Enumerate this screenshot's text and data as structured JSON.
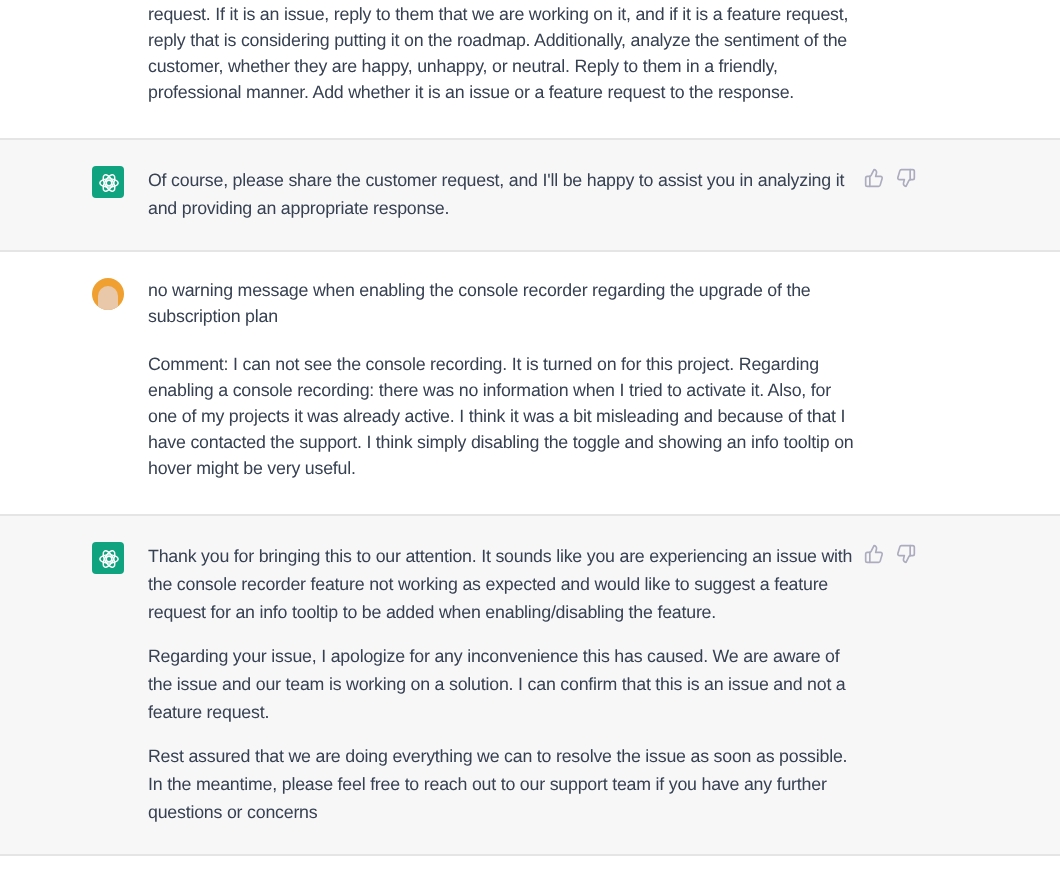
{
  "messages": [
    {
      "kind": "user",
      "paragraphs": [
        "request. If it is an issue, reply to them that we are working on it, and if it is a feature request, reply that is considering putting it on the roadmap. Additionally, analyze the sentiment of the customer, whether they are happy, unhappy, or neutral. Reply to them in a friendly, professional manner. Add whether it is an issue or a feature request to the response."
      ]
    },
    {
      "kind": "assistant",
      "paragraphs": [
        "Of course, please share the customer request, and I'll be happy to assist you in analyzing it and providing an appropriate response."
      ]
    },
    {
      "kind": "user",
      "paragraphs": [
        "no warning message when enabling the console recorder regarding the upgrade of the subscription plan",
        "Comment: I can not see the console recording. It is turned on for this project. Regarding enabling a console recording: there was no information when I tried to activate it. Also, for one of my projects it was already active. I think it was a bit misleading and because of that I have contacted the support. I think simply disabling the toggle and showing an info tooltip on hover might be very useful."
      ]
    },
    {
      "kind": "assistant",
      "paragraphs": [
        "Thank you for bringing this to our attention. It sounds like you are experiencing an issue with the console recorder feature not working as expected and would like to suggest a feature request for an info tooltip to be added when enabling/disabling the feature.",
        "Regarding your issue, I apologize for any inconvenience this has caused. We are aware of the issue and our team is working on a solution. I can confirm that this is an issue and not a feature request.",
        "Rest assured that we are doing everything we can to resolve the issue as soon as possible. In the meantime, please feel free to reach out to our support team if you have any further questions or concerns"
      ]
    }
  ]
}
